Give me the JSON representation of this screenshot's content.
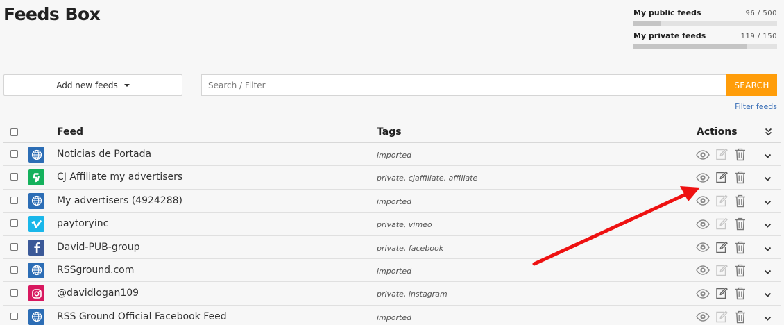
{
  "page": {
    "title": "Feeds Box"
  },
  "quotas": [
    {
      "label": "My public feeds",
      "value": "96 / 500",
      "fraction": 0.192
    },
    {
      "label": "My private feeds",
      "value": "119 / 150",
      "fraction": 0.793
    }
  ],
  "toolbar": {
    "add_label": "Add new feeds",
    "search_placeholder": "Search / Filter",
    "search_label": "SEARCH",
    "filter_link": "Filter feeds"
  },
  "table": {
    "headers": {
      "feed": "Feed",
      "tags": "Tags",
      "actions": "Actions"
    },
    "rows": [
      {
        "name": "Noticias de Portada",
        "tags": "imported",
        "icon": "globe-icon",
        "icon_bg": "#2c6db5",
        "edit_active": false
      },
      {
        "name": "CJ Affiliate my advertisers",
        "tags": "private, cjaffiliate, affiliate",
        "icon": "cj-icon",
        "icon_bg": "#14b15c",
        "edit_active": true
      },
      {
        "name": "My advertisers (4924288)",
        "tags": "imported",
        "icon": "globe-icon",
        "icon_bg": "#2c6db5",
        "edit_active": false
      },
      {
        "name": "paytoryinc",
        "tags": "private, vimeo",
        "icon": "vimeo-icon",
        "icon_bg": "#1ab7ea",
        "edit_active": false
      },
      {
        "name": "David-PUB-group",
        "tags": "private, facebook",
        "icon": "facebook-icon",
        "icon_bg": "#3b5998",
        "edit_active": true
      },
      {
        "name": "RSSground.com",
        "tags": "imported",
        "icon": "globe-icon",
        "icon_bg": "#2c6db5",
        "edit_active": false
      },
      {
        "name": "@davidlogan109",
        "tags": "private, instagram",
        "icon": "instagram-icon",
        "icon_bg": "#d8185f",
        "edit_active": true
      },
      {
        "name": "RSS Ground Official Facebook Feed",
        "tags": "imported",
        "icon": "globe-icon",
        "icon_bg": "#2c6db5",
        "edit_active": false
      }
    ]
  },
  "colors": {
    "accent": "#ff9d0a",
    "link": "#3a6fb7",
    "annotation_arrow": "#ee1111"
  }
}
